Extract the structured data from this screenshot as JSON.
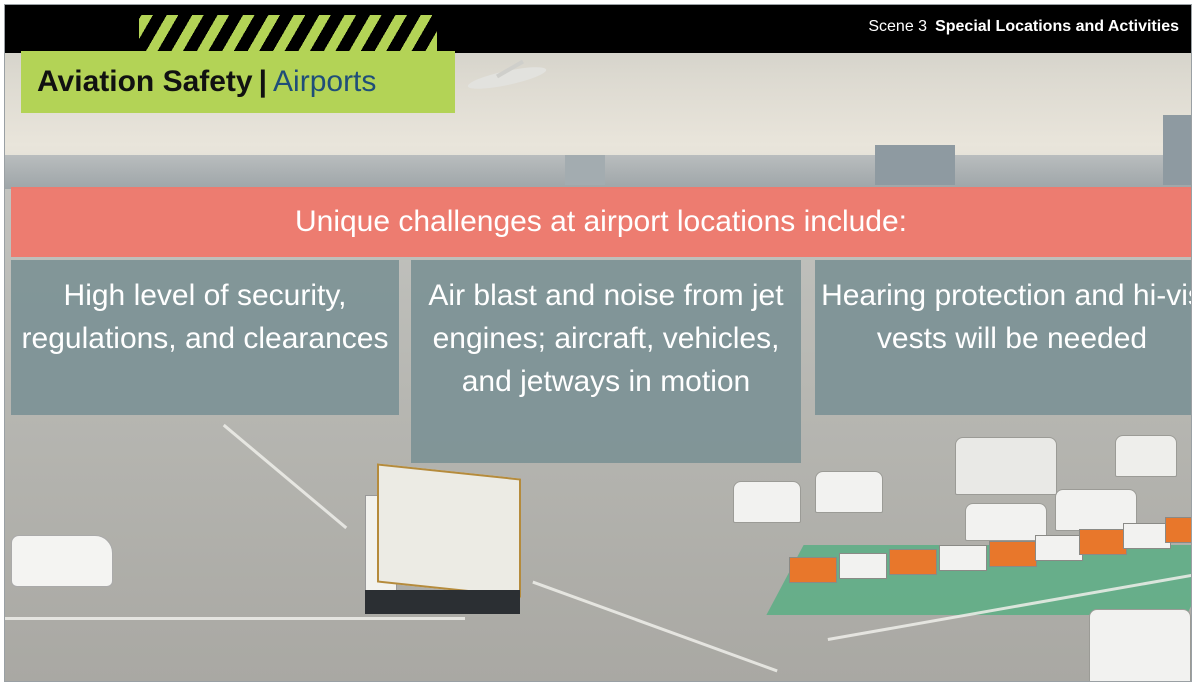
{
  "header": {
    "scene_number": "Scene 3",
    "scene_title": "Special Locations and Activities"
  },
  "title": {
    "main": "Aviation Safety",
    "separator": "|",
    "sub": "Airports"
  },
  "banner": {
    "text": "Unique challenges at airport locations include:"
  },
  "cards": [
    {
      "text": "High level of security, regulations, and clearances"
    },
    {
      "text": "Air blast and noise from jet engines; aircraft, vehicles, and jetways in motion"
    },
    {
      "text": "Hearing protection and hi-vis vests will be needed"
    }
  ],
  "colors": {
    "accent_green": "#b3d356",
    "banner_salmon": "#ef786c",
    "card_gray": "#7d9296",
    "title_blue": "#1f4e79"
  },
  "icons": {
    "hazard": "hazard-stripes-icon"
  }
}
